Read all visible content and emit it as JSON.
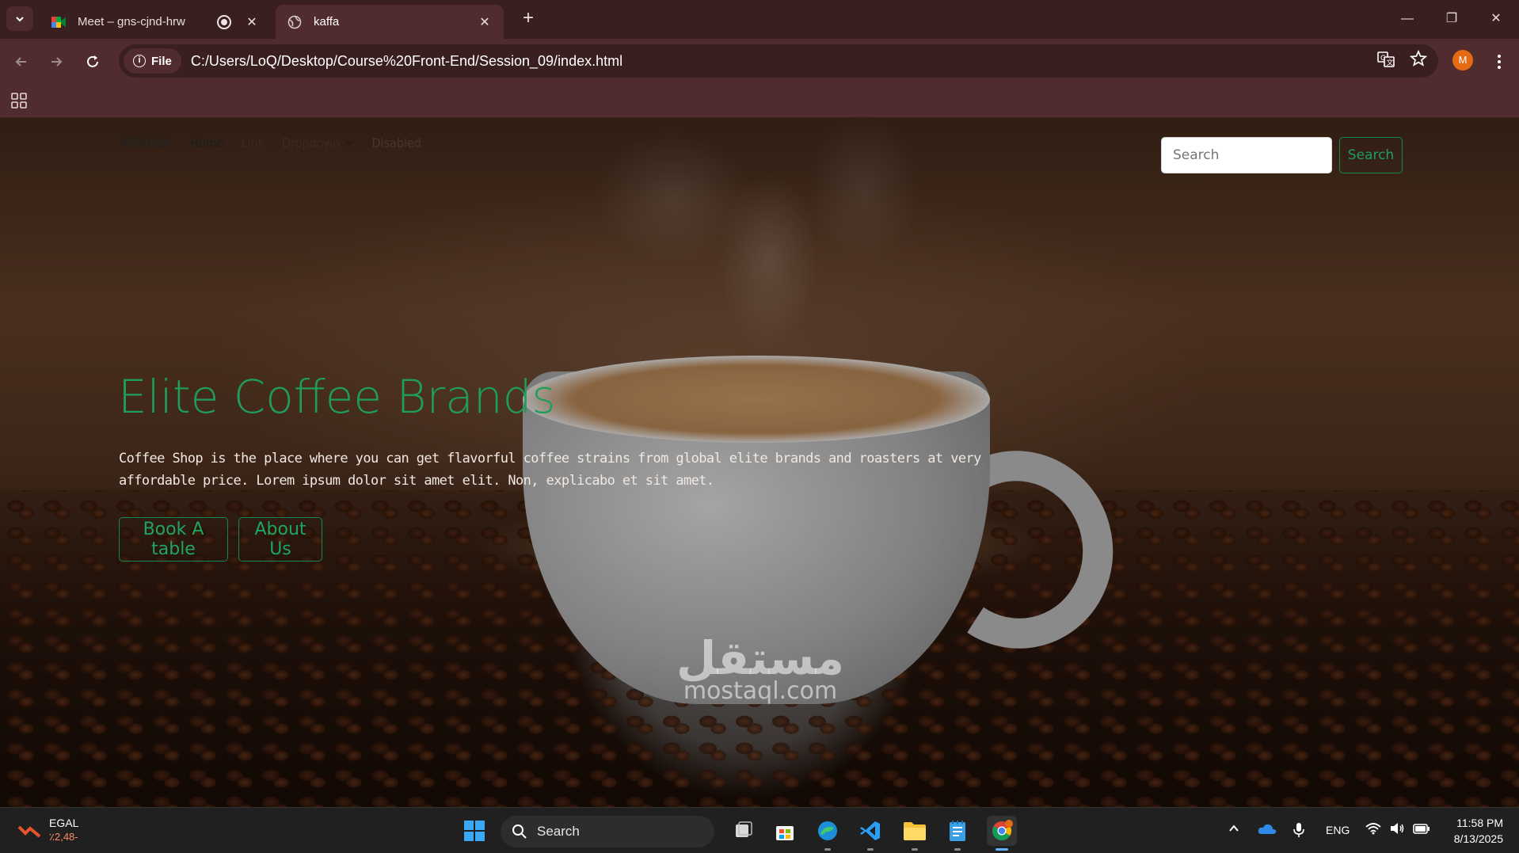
{
  "browser": {
    "tabs": [
      {
        "title": "Meet – gns-cjnd-hrw",
        "active": false
      },
      {
        "title": "kaffa",
        "active": true
      }
    ],
    "address": {
      "scheme_chip": "File",
      "url": "C:/Users/LoQ/Desktop/Course%20Front-End/Session_09/index.html"
    },
    "profile_initial": "M"
  },
  "page": {
    "navbar": {
      "brand": "Navbar",
      "links": [
        "Home",
        "Link",
        "Dropdown",
        "Disabled"
      ],
      "search_placeholder": "Search",
      "search_button": "Search"
    },
    "hero": {
      "title": "Elite Coffee Brands",
      "text": "Coffee Shop is the place where you can get flavorful coffee strains from global elite brands and roasters at very affordable price. Lorem ipsum dolor sit amet elit. Non, explicabo et sit amet.",
      "buttons": [
        "Book A table",
        "About Us"
      ]
    },
    "watermark": {
      "arabic": "مستقل",
      "latin": "mostaql.com"
    },
    "colors": {
      "accent_green": "#198754",
      "browser_frame": "#512c2e"
    }
  },
  "taskbar": {
    "stock": {
      "ticker": "EGAL",
      "change": "٪2,48-"
    },
    "search_label": "Search",
    "language": "ENG",
    "time": "11:58 PM",
    "date": "8/13/2025"
  }
}
